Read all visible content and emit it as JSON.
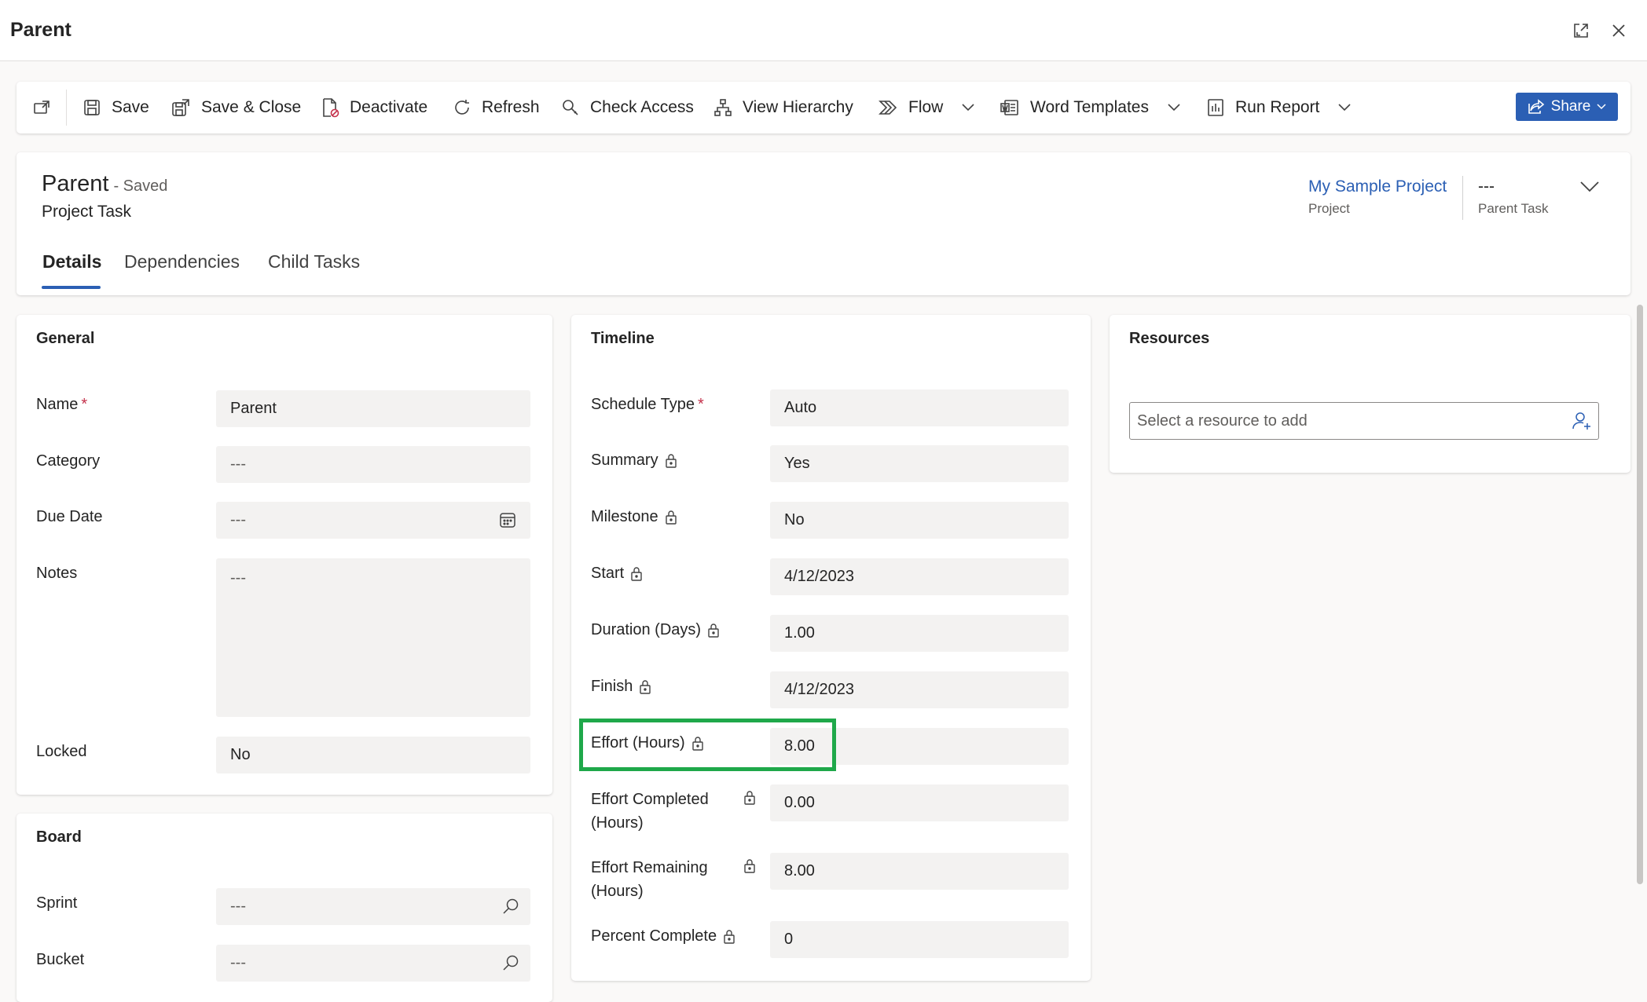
{
  "window": {
    "title": "Parent"
  },
  "toolbar": {
    "save": "Save",
    "save_close": "Save & Close",
    "deactivate": "Deactivate",
    "refresh": "Refresh",
    "check_access": "Check Access",
    "view_hierarchy": "View Hierarchy",
    "flow": "Flow",
    "word_templates": "Word Templates",
    "run_report": "Run Report",
    "share": "Share"
  },
  "record": {
    "title": "Parent",
    "status": "- Saved",
    "entity": "Project Task",
    "project_value": "My Sample Project",
    "project_label": "Project",
    "parent_task_value": "---",
    "parent_task_label": "Parent Task"
  },
  "tabs": [
    "Details",
    "Dependencies",
    "Child Tasks"
  ],
  "general": {
    "title": "General",
    "name_label": "Name",
    "name_value": "Parent",
    "category_label": "Category",
    "category_value": "---",
    "due_date_label": "Due Date",
    "due_date_value": "---",
    "notes_label": "Notes",
    "notes_value": "---",
    "locked_label": "Locked",
    "locked_value": "No"
  },
  "board": {
    "title": "Board",
    "sprint_label": "Sprint",
    "sprint_value": "---",
    "bucket_label": "Bucket",
    "bucket_value": "---"
  },
  "timeline": {
    "title": "Timeline",
    "fields": [
      {
        "label": "Schedule Type",
        "value": "Auto"
      },
      {
        "label": "Summary",
        "value": "Yes"
      },
      {
        "label": "Milestone",
        "value": "No"
      },
      {
        "label": "Start",
        "value": "4/12/2023"
      },
      {
        "label": "Duration (Days)",
        "value": "1.00"
      },
      {
        "label": "Finish",
        "value": "4/12/2023"
      },
      {
        "label": "Effort (Hours)",
        "value": "8.00"
      },
      {
        "label_line1": "Effort Completed",
        "label_line2": "(Hours)",
        "value": "0.00"
      },
      {
        "label_line1": "Effort Remaining",
        "label_line2": "(Hours)",
        "value": "8.00"
      },
      {
        "label": "Percent Complete",
        "value": "0"
      }
    ]
  },
  "resources": {
    "title": "Resources",
    "placeholder": "Select a resource to add"
  },
  "colors": {
    "accent": "#2b5fb4",
    "highlight": "#1fa84a",
    "required": "#c4314b"
  }
}
